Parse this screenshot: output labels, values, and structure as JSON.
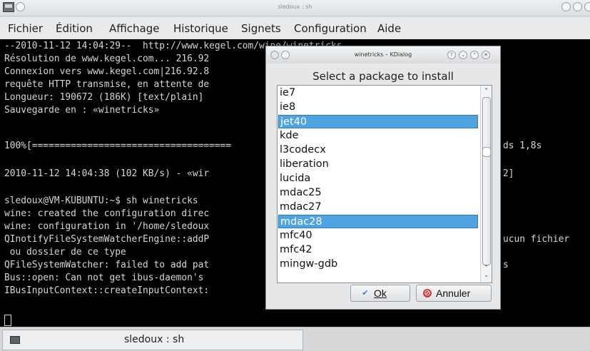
{
  "window": {
    "title": "sledoux : sh"
  },
  "menu": [
    "Fichier",
    "Édition",
    "Affichage",
    "Historique",
    "Signets",
    "Configuration",
    "Aide"
  ],
  "terminal": {
    "lines": [
      "--2010-11-12 14:04:29--  http://www.kegel.com/wine/winetricks",
      "Résolution de www.kegel.com... 216.92",
      "Connexion vers www.kegel.com|216.92.8",
      "requête HTTP transmise, en attente de",
      "Longueur: 190672 (186K) [text/plain]",
      "Sauvegarde en : «winetricks»",
      "",
      "100%[====================================",
      "",
      "2010-11-12 14:04:38 (102 KB/s) - «wir",
      "",
      "sledoux@VM-KUBUNTU:~$ sh winetricks",
      "wine: created the configuration direc",
      "wine: configuration in '/home/sledoux",
      "QInotifyFileSystemWatcherEngine::addP",
      " ou dossier de ce type",
      "QFileSystemWatcher: failed to add pat",
      "Bus::open: Can not get ibus-daemon's",
      "IBusInputContext::createInputContext:"
    ],
    "right_fragments": {
      "download_speed": "ds 1,8s",
      "saved_suffix": "2]",
      "error_suffix": "ucun fichier",
      "watcher_suffix": "s"
    }
  },
  "tab": {
    "label": "sledoux : sh"
  },
  "dialog": {
    "title": "winetricks – KDialog",
    "heading": "Select a package to install",
    "items": [
      "ie7",
      "ie8",
      "jet40",
      "kde",
      "l3codecx",
      "liberation",
      "lucida",
      "mdac25",
      "mdac27",
      "mdac28",
      "mfc40",
      "mfc42",
      "mingw-gdb"
    ],
    "selected": [
      "jet40",
      "mdac28"
    ],
    "ok_label": "Ok",
    "cancel_label": "Annuler"
  },
  "colors": {
    "selection": "#4fa3e0",
    "terminal_bg": "#000000",
    "terminal_fg": "#d6d6d6"
  }
}
